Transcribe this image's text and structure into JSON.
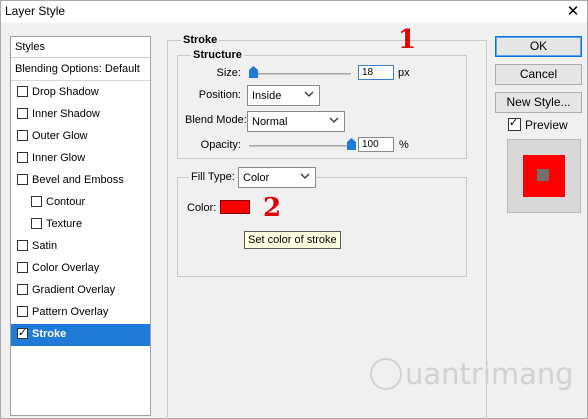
{
  "window": {
    "title": "Layer Style",
    "close_glyph": "✕"
  },
  "styles_panel": {
    "header": "Styles",
    "blending": "Blending Options: Default",
    "items": [
      {
        "label": "Drop Shadow",
        "checked": false
      },
      {
        "label": "Inner Shadow",
        "checked": false
      },
      {
        "label": "Outer Glow",
        "checked": false
      },
      {
        "label": "Inner Glow",
        "checked": false
      },
      {
        "label": "Bevel and Emboss",
        "checked": false
      },
      {
        "label": "Contour",
        "checked": false
      },
      {
        "label": "Texture",
        "checked": false
      },
      {
        "label": "Satin",
        "checked": false
      },
      {
        "label": "Color Overlay",
        "checked": false
      },
      {
        "label": "Gradient Overlay",
        "checked": false
      },
      {
        "label": "Pattern Overlay",
        "checked": false
      },
      {
        "label": "Stroke",
        "checked": true
      }
    ]
  },
  "stroke": {
    "legend": "Stroke",
    "structure_legend": "Structure",
    "size_label": "Size:",
    "size_value": "18",
    "size_unit": "px",
    "size_slider_fraction": 0.04,
    "position_label": "Position:",
    "position_value": "Inside",
    "blend_label": "Blend Mode:",
    "blend_value": "Normal",
    "opacity_label": "Opacity:",
    "opacity_value": "100",
    "opacity_unit": "%",
    "opacity_slider_fraction": 1.0,
    "fill_type_label": "Fill Type:",
    "fill_type_value": "Color",
    "color_label": "Color:",
    "color_hex": "#ff0000",
    "tooltip": "Set color of stroke"
  },
  "buttons": {
    "ok": "OK",
    "cancel": "Cancel",
    "new_style": "New Style...",
    "preview_label": "Preview",
    "preview_checked": true
  },
  "annotations": {
    "one": "1",
    "two": "2"
  },
  "watermark": "uantrimang",
  "colors": {
    "accent": "#1f7ad8",
    "stroke_color": "#ff0000",
    "annotation": "#e00000"
  }
}
